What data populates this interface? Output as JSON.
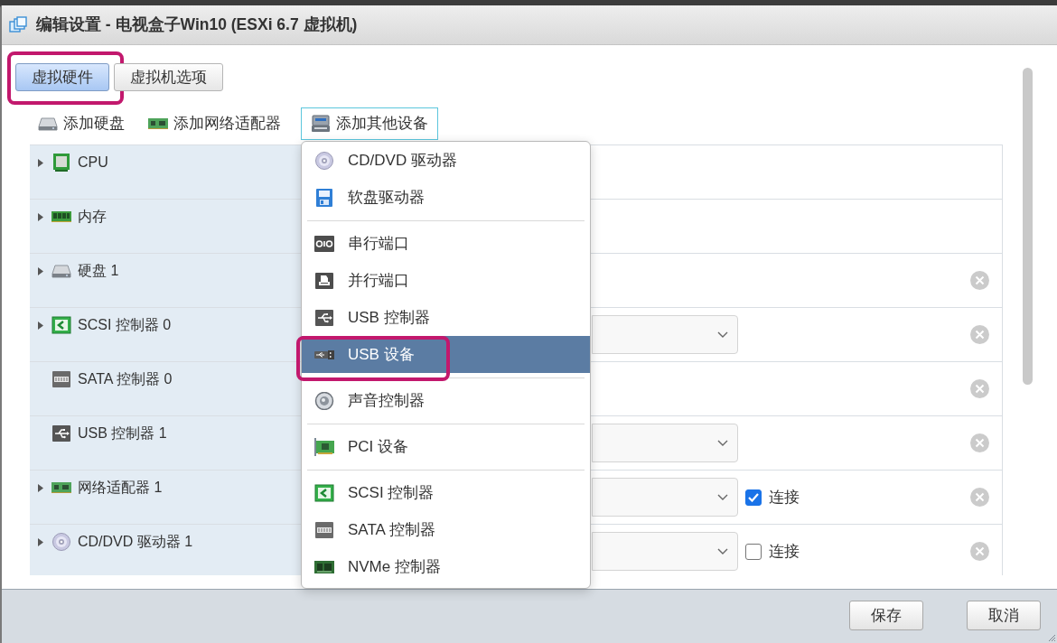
{
  "window": {
    "title": "编辑设置 - 电视盒子Win10 (ESXi 6.7 虚拟机)"
  },
  "tabs": [
    {
      "label": "虚拟硬件",
      "selected": true,
      "highlighted": true
    },
    {
      "label": "虚拟机选项",
      "selected": false,
      "highlighted": false
    }
  ],
  "toolbar": [
    {
      "kind": "disk",
      "label": "添加硬盘",
      "expanded": false
    },
    {
      "kind": "network",
      "label": "添加网络适配器",
      "expanded": false
    },
    {
      "kind": "device",
      "label": "添加其他设备",
      "expanded": true
    }
  ],
  "hardware": [
    {
      "kind": "cpu",
      "label": "CPU",
      "expandable": true,
      "dropdown": false,
      "removable": false
    },
    {
      "kind": "memory",
      "label": "内存",
      "expandable": true,
      "dropdown": false,
      "removable": false
    },
    {
      "kind": "disk",
      "label": "硬盘 1",
      "expandable": true,
      "dropdown": false,
      "removable": true
    },
    {
      "kind": "scsi",
      "label": "SCSI 控制器 0",
      "expandable": true,
      "dropdown": true,
      "removable": true
    },
    {
      "kind": "sata",
      "label": "SATA 控制器 0",
      "expandable": false,
      "dropdown": false,
      "removable": true
    },
    {
      "kind": "usb",
      "label": "USB 控制器 1",
      "expandable": false,
      "dropdown": true,
      "removable": true
    },
    {
      "kind": "network",
      "label": "网络适配器 1",
      "expandable": true,
      "dropdown": true,
      "removable": true,
      "connect": {
        "label": "连接",
        "checked": true
      }
    },
    {
      "kind": "cdrom",
      "label": "CD/DVD 驱动器 1",
      "expandable": true,
      "dropdown": true,
      "removable": true,
      "connect": {
        "label": "连接",
        "checked": false
      }
    }
  ],
  "add_device_menu": {
    "groups": [
      {
        "items": [
          {
            "kind": "cdrom",
            "label": "CD/DVD 驱动器",
            "selected": false,
            "highlighted": false
          },
          {
            "kind": "floppy",
            "label": "软盘驱动器",
            "selected": false,
            "highlighted": false
          }
        ]
      },
      {
        "items": [
          {
            "kind": "serial",
            "label": "串行端口",
            "selected": false,
            "highlighted": false
          },
          {
            "kind": "parallel",
            "label": "并行端口",
            "selected": false,
            "highlighted": false
          },
          {
            "kind": "usb",
            "label": "USB 控制器",
            "selected": false,
            "highlighted": false
          },
          {
            "kind": "usbdevice",
            "label": "USB 设备",
            "selected": true,
            "highlighted": true
          }
        ]
      },
      {
        "items": [
          {
            "kind": "sound",
            "label": "声音控制器",
            "selected": false,
            "highlighted": false
          }
        ]
      },
      {
        "items": [
          {
            "kind": "pci",
            "label": "PCI 设备",
            "selected": false,
            "highlighted": false
          }
        ]
      },
      {
        "items": [
          {
            "kind": "scsi",
            "label": "SCSI 控制器",
            "selected": false,
            "highlighted": false
          },
          {
            "kind": "sata",
            "label": "SATA 控制器",
            "selected": false,
            "highlighted": false
          },
          {
            "kind": "nvme",
            "label": "NVMe 控制器",
            "selected": false,
            "highlighted": false
          }
        ]
      }
    ]
  },
  "buttons": [
    {
      "label": "保存"
    },
    {
      "label": "取消"
    }
  ]
}
